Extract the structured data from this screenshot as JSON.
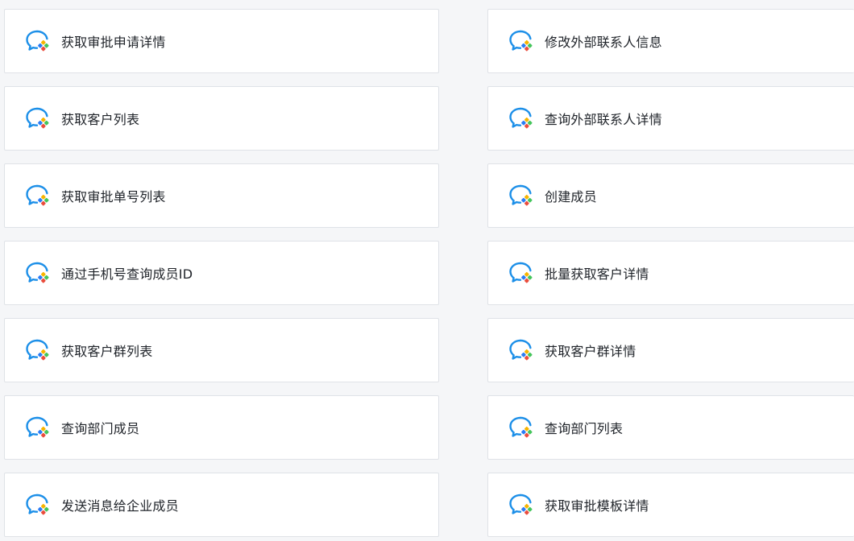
{
  "colors": {
    "page_background": "#f5f6f8",
    "card_background": "#ffffff",
    "card_border": "#dfe2e7",
    "text": "#1f2329",
    "icon_bubble": "#1c8fe8",
    "icon_accent_yellow": "#f7b500",
    "icon_accent_green": "#44c55b",
    "icon_accent_red": "#ea4d3d",
    "icon_accent_blue": "#2a7cf6"
  },
  "icon": "wecom-chat-bubble-icon",
  "cards": [
    {
      "label": "获取审批申请详情"
    },
    {
      "label": "修改外部联系人信息"
    },
    {
      "label": "获取客户列表"
    },
    {
      "label": "查询外部联系人详情"
    },
    {
      "label": "获取审批单号列表"
    },
    {
      "label": "创建成员"
    },
    {
      "label": "通过手机号查询成员ID"
    },
    {
      "label": "批量获取客户详情"
    },
    {
      "label": "获取客户群列表"
    },
    {
      "label": "获取客户群详情"
    },
    {
      "label": "查询部门成员"
    },
    {
      "label": "查询部门列表"
    },
    {
      "label": "发送消息给企业成员"
    },
    {
      "label": "获取审批模板详情"
    }
  ]
}
